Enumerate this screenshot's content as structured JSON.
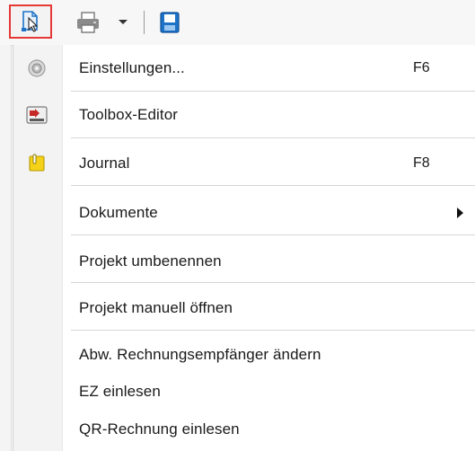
{
  "menu": {
    "items": [
      {
        "label": "Einstellungen...",
        "shortcut": "F6",
        "icon": "settings-disc-icon"
      },
      {
        "label": "Toolbox-Editor",
        "shortcut": "",
        "icon": "toolbox-editor-icon"
      },
      {
        "label": "Journal",
        "shortcut": "F8",
        "icon": "journal-folder-icon"
      },
      {
        "label": "Dokumente",
        "shortcut": "",
        "icon": "",
        "submenu": true
      },
      {
        "label": "Projekt umbenennen",
        "shortcut": "",
        "icon": ""
      },
      {
        "label": "Projekt manuell öffnen",
        "shortcut": "",
        "icon": ""
      },
      {
        "label": "Abw. Rechnungsempfänger ändern",
        "shortcut": "",
        "icon": ""
      },
      {
        "label": "EZ einlesen",
        "shortcut": "",
        "icon": ""
      },
      {
        "label": "QR-Rechnung einlesen",
        "shortcut": "",
        "icon": ""
      }
    ]
  },
  "toolbar": {
    "buttons": [
      {
        "name": "open-menu-button",
        "icon": "document-cursor-icon",
        "active": true
      },
      {
        "name": "print-button",
        "icon": "printer-icon"
      },
      {
        "name": "print-options-dropdown",
        "icon": "chevron-down-icon"
      },
      {
        "name": "save-button",
        "icon": "floppy-disk-icon"
      }
    ]
  },
  "colors": {
    "active_border": "#e53935",
    "accent_blue": "#1e73c8",
    "journal_yellow": "#f4d21a",
    "toolbox_red": "#c62828"
  }
}
